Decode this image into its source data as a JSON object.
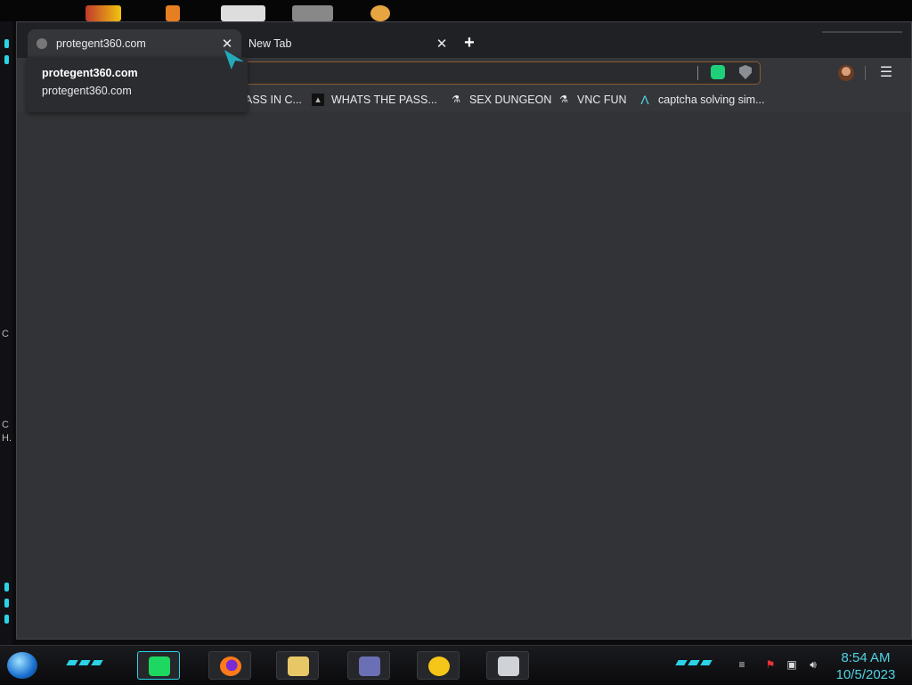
{
  "browser": {
    "tabs": [
      {
        "title": "protegent360.com",
        "close": "✕"
      },
      {
        "title": "New Tab",
        "close": "✕"
      }
    ],
    "new_tab_icon": "+",
    "menu_icon": "☰",
    "hover_card": {
      "title": "protegent360.com",
      "url": "protegent360.com"
    },
    "bookmarks": [
      {
        "label": "ASS IN C...",
        "icon": "document-icon"
      },
      {
        "label": "WHATS THE PASS...",
        "icon": "image-icon"
      },
      {
        "label": "SEX DUNGEON",
        "icon": "flask-icon"
      },
      {
        "label": "VNC FUN",
        "icon": "flask-icon"
      },
      {
        "label": "captcha solving sim...",
        "icon": "lambda-icon"
      }
    ]
  },
  "desktop": {
    "edge_text": [
      "C",
      "C",
      "H."
    ]
  },
  "taskbar": {
    "time": "8:54 AM",
    "date": "10/5/2023",
    "apps": [
      "spotify",
      "firefox",
      "file-explorer",
      "id-card-app",
      "p-app",
      "system-monitor"
    ]
  },
  "colors": {
    "accent_cyan": "#2bd3e6",
    "clock": "#4fd4e3",
    "omnibox_border": "#8a5a2e"
  }
}
